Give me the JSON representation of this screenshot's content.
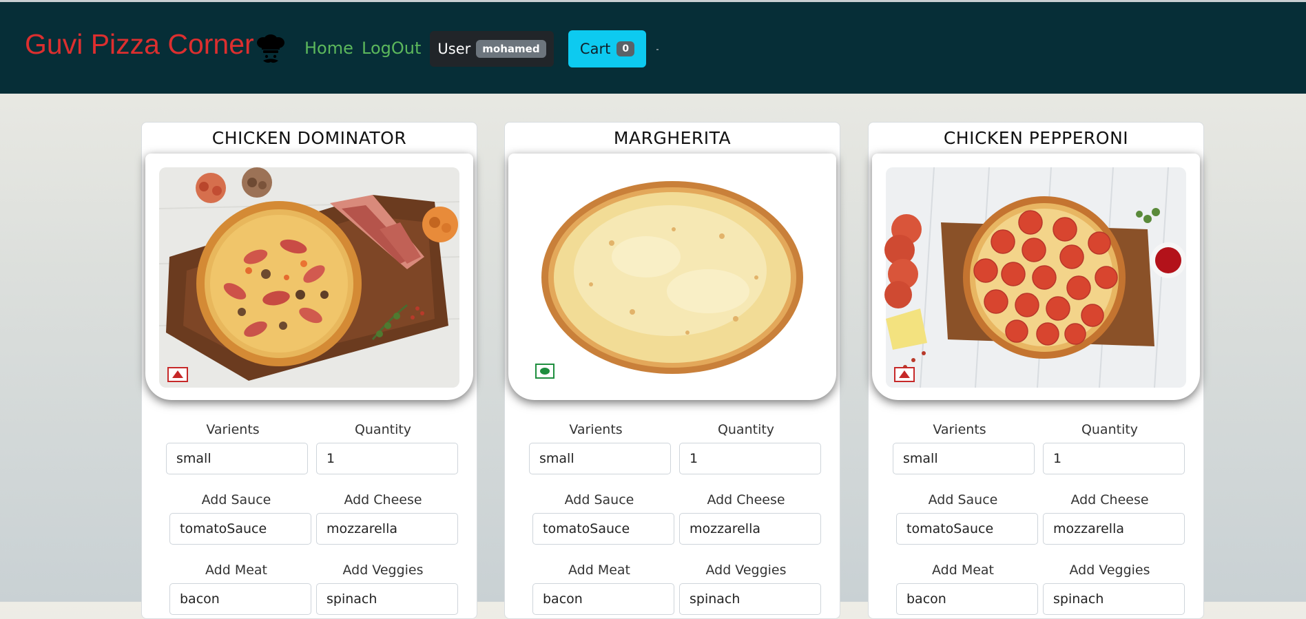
{
  "navbar": {
    "brand": "Guvi Pizza Corner",
    "links": [
      "Home",
      "LogOut"
    ],
    "user_label": "User",
    "user_name": "mohamed",
    "cart_label": "Cart",
    "cart_count": "0"
  },
  "pizzas": [
    {
      "name": "CHICKEN DOMINATOR",
      "diet": "non-veg",
      "fields": {
        "varients_label": "Varients",
        "varients": "small",
        "quantity_label": "Quantity",
        "quantity": "1",
        "sauce_label": "Add Sauce",
        "sauce": "tomatoSauce",
        "cheese_label": "Add Cheese",
        "cheese": "mozzarella",
        "meat_label": "Add Meat",
        "meat": "bacon",
        "veggies_label": "Add Veggies",
        "veggies": "spinach"
      }
    },
    {
      "name": "MARGHERITA",
      "diet": "veg",
      "fields": {
        "varients_label": "Varients",
        "varients": "small",
        "quantity_label": "Quantity",
        "quantity": "1",
        "sauce_label": "Add Sauce",
        "sauce": "tomatoSauce",
        "cheese_label": "Add Cheese",
        "cheese": "mozzarella",
        "meat_label": "Add Meat",
        "meat": "bacon",
        "veggies_label": "Add Veggies",
        "veggies": "spinach"
      }
    },
    {
      "name": "CHICKEN PEPPERONI",
      "diet": "non-veg",
      "fields": {
        "varients_label": "Varients",
        "varients": "small",
        "quantity_label": "Quantity",
        "quantity": "1",
        "sauce_label": "Add Sauce",
        "sauce": "tomatoSauce",
        "cheese_label": "Add Cheese",
        "cheese": "mozzarella",
        "meat_label": "Add Meat",
        "meat": "bacon",
        "veggies_label": "Add Veggies",
        "veggies": "spinach"
      }
    }
  ],
  "colors": {
    "navbar_bg": "#062e37",
    "brand": "#dc2f2f",
    "nav_link": "#5cb85c",
    "cart_button": "#0dcaf0",
    "non_veg_mark": "#c62828",
    "veg_mark": "#1e8e3e"
  }
}
